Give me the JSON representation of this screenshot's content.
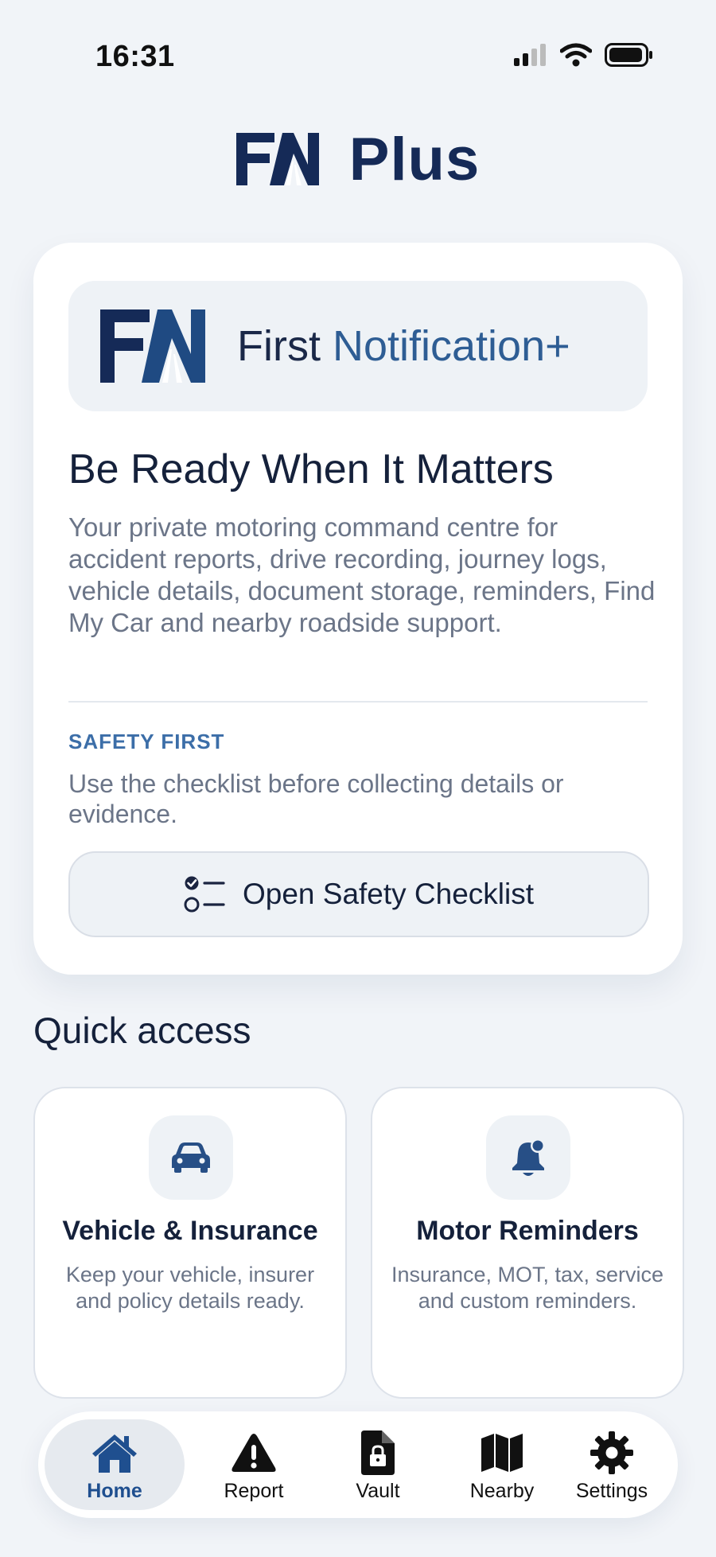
{
  "status_bar": {
    "time": "16:31"
  },
  "app_header": {
    "logo_text": "Plus",
    "logo_mark": "FN"
  },
  "hero": {
    "brand": {
      "mark": "FN",
      "name_prefix": "First ",
      "name_accent": "Notification+"
    },
    "title": "Be Ready When It Matters",
    "description": "Your private motoring command centre for accident reports, drive recording, journey logs, vehicle details, document storage, reminders, Find My Car and nearby roadside support.",
    "safety_label": "SAFETY FIRST",
    "safety_text": "Use the checklist before collecting details or evidence.",
    "checklist_button": {
      "label": "Open Safety Checklist",
      "icon": "checklist-icon"
    }
  },
  "quick_access": {
    "title": "Quick access",
    "cards": [
      {
        "title": "Vehicle & Insurance",
        "description": "Keep your vehicle, insurer and policy details ready.",
        "icon": "car-icon"
      },
      {
        "title": "Motor Reminders",
        "description": "Insurance, MOT, tax, service and custom reminders.",
        "icon": "bell-icon"
      }
    ]
  },
  "tab_bar": {
    "active": "Home",
    "tabs": [
      {
        "label": "Home",
        "icon": "home-icon"
      },
      {
        "label": "Report",
        "icon": "warning-icon"
      },
      {
        "label": "Vault",
        "icon": "lock-file-icon"
      },
      {
        "label": "Nearby",
        "icon": "map-icon"
      },
      {
        "label": "Settings",
        "icon": "gear-icon"
      }
    ]
  },
  "colors": {
    "accent": "#2e5d94",
    "navy": "#152a57",
    "background": "#f1f4f8"
  }
}
